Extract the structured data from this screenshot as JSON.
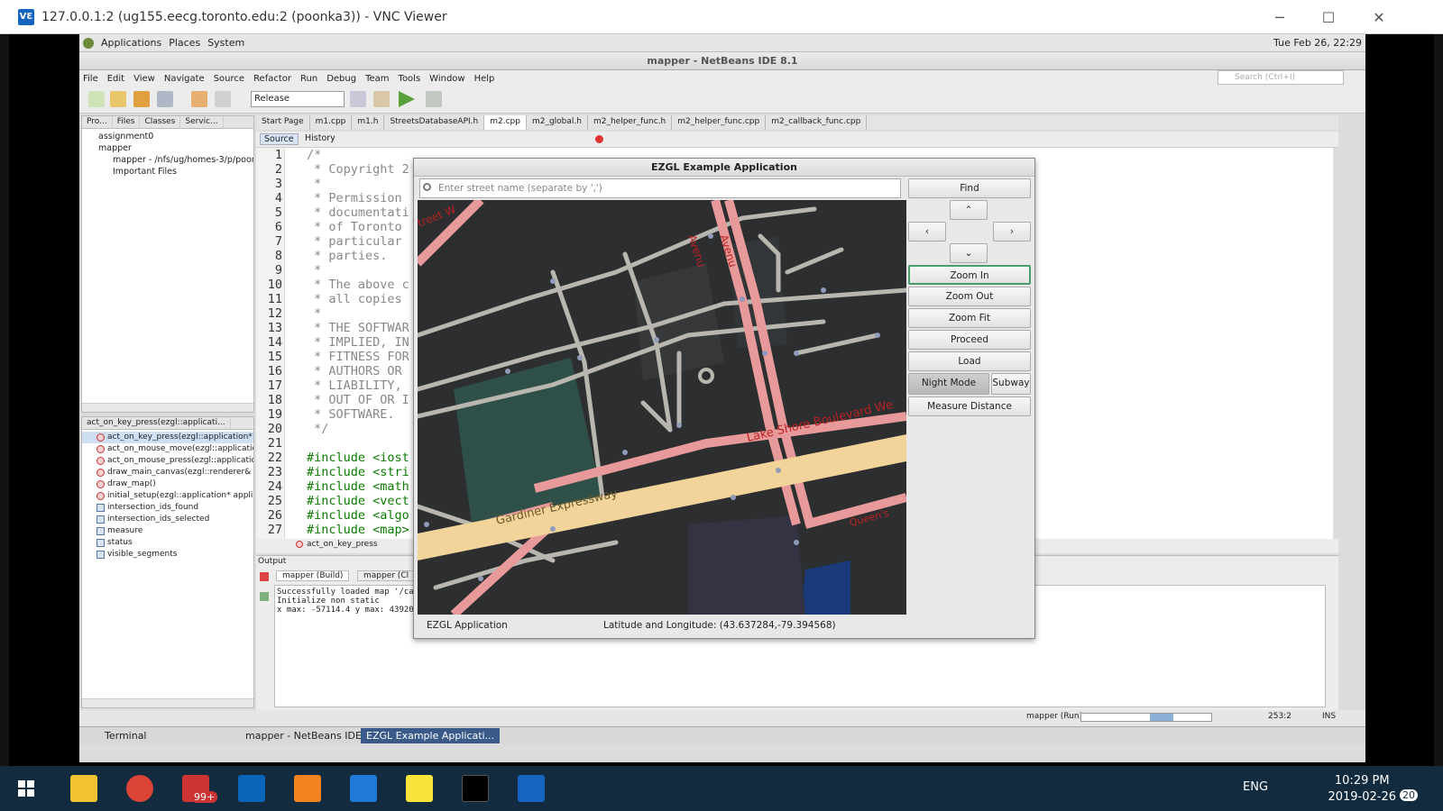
{
  "vnc": {
    "title": "127.0.0.1:2 (ug155.eecg.toronto.edu:2 (poonka3)) - VNC Viewer",
    "logo": "VƐ"
  },
  "gnome": {
    "menus": [
      "Applications",
      "Places",
      "System"
    ],
    "clock": "Tue Feb 26, 22:29"
  },
  "netbeans": {
    "title": "mapper - NetBeans IDE 8.1",
    "menus": [
      "File",
      "Edit",
      "View",
      "Navigate",
      "Source",
      "Refactor",
      "Run",
      "Debug",
      "Team",
      "Tools",
      "Window",
      "Help"
    ],
    "search_placeholder": "Search (Ctrl+I)",
    "config": "Release",
    "project_tabs": [
      "Pro...",
      "Files",
      "Classes",
      "Servic..."
    ],
    "tree": [
      "assignment0",
      "mapper",
      "mapper - /nfs/ug/homes-3/p/poonl",
      "Important Files"
    ],
    "navigator_title": "act_on_key_press(ezgl::applicati...",
    "navigator_items": [
      {
        "label": "act_on_key_press(ezgl::application* a",
        "kind": "fn"
      },
      {
        "label": "act_on_mouse_move(ezgl::application",
        "kind": "fn"
      },
      {
        "label": "act_on_mouse_press(ezgl::application",
        "kind": "fn"
      },
      {
        "label": "draw_main_canvas(ezgl::renderer& g)",
        "kind": "fn"
      },
      {
        "label": "draw_map()",
        "kind": "fn"
      },
      {
        "label": "initial_setup(ezgl::application* applicat",
        "kind": "fn"
      },
      {
        "label": "intersection_ids_found",
        "kind": "field"
      },
      {
        "label": "intersection_ids_selected",
        "kind": "field"
      },
      {
        "label": "measure",
        "kind": "field"
      },
      {
        "label": "status",
        "kind": "field"
      },
      {
        "label": "visible_segments",
        "kind": "field"
      }
    ],
    "editor_tabs": [
      "Start Page",
      "m1.cpp",
      "m1.h",
      "StreetsDatabaseAPI.h",
      "m2.cpp",
      "m2_global.h",
      "m2_helper_func.h",
      "m2_helper_func.cpp",
      "m2_callback_func.cpp"
    ],
    "source_tab": "Source",
    "history_tab": "History",
    "line_numbers": [
      "1",
      "2",
      "3",
      "4",
      "5",
      "6",
      "7",
      "8",
      "9",
      "10",
      "11",
      "12",
      "13",
      "14",
      "15",
      "16",
      "17",
      "18",
      "19",
      "20",
      "21",
      "22",
      "23",
      "24",
      "25",
      "26",
      "27"
    ],
    "code_lines": [
      "/*",
      " * Copyright 2",
      " *",
      " * Permission",
      " * documentati",
      " * of Toronto",
      " * particular",
      " * parties.",
      " *",
      " * The above c",
      " * all copies",
      " *",
      " * THE SOFTWAR",
      " * IMPLIED, IN",
      " * FITNESS FOR",
      " * AUTHORS OR",
      " * LIABILITY,",
      " * OUT OF OR I",
      " * SOFTWARE.",
      " */",
      "",
      "#include <iost",
      "#include <stri",
      "#include <math",
      "#include <vect",
      "#include <algo",
      "#include <map>"
    ],
    "breadcrumb": "act_on_key_press",
    "output_tab": "Output",
    "output_subtabs": [
      "mapper (Build)",
      "mapper (Cl"
    ],
    "output_lines": [
      "Successfully loaded map '/ca",
      "Initialize non static",
      "x max: -57114.4 y max: 43920"
    ],
    "status_run": "mapper (Run)",
    "status_pos": "253:2",
    "status_mode": "INS",
    "tasks": [
      "Terminal",
      "mapper - NetBeans IDE ...",
      "EZGL Example Applicati..."
    ]
  },
  "ezgl": {
    "title": "EZGL Example Application",
    "search_placeholder": "Enter street name (separate by ',')",
    "buttons": {
      "find": "Find",
      "zoom_in": "Zoom In",
      "zoom_out": "Zoom Out",
      "zoom_fit": "Zoom Fit",
      "proceed": "Proceed",
      "load": "Load",
      "night_mode": "Night Mode",
      "subway": "Subway",
      "measure": "Measure Distance"
    },
    "status": "EZGL Application",
    "coords": "Latitude and Longitude: (43.637284,-79.394568)",
    "map_labels": [
      "treet W",
      "Lake Shore Boulevard We",
      "Gardiner Expressway",
      "Queen's",
      "Avenu",
      "Avenu"
    ]
  },
  "windows": {
    "lang": "ENG",
    "time": "10:29 PM",
    "date": "2019-02-26",
    "notif_count": "20",
    "badge": "99+"
  }
}
